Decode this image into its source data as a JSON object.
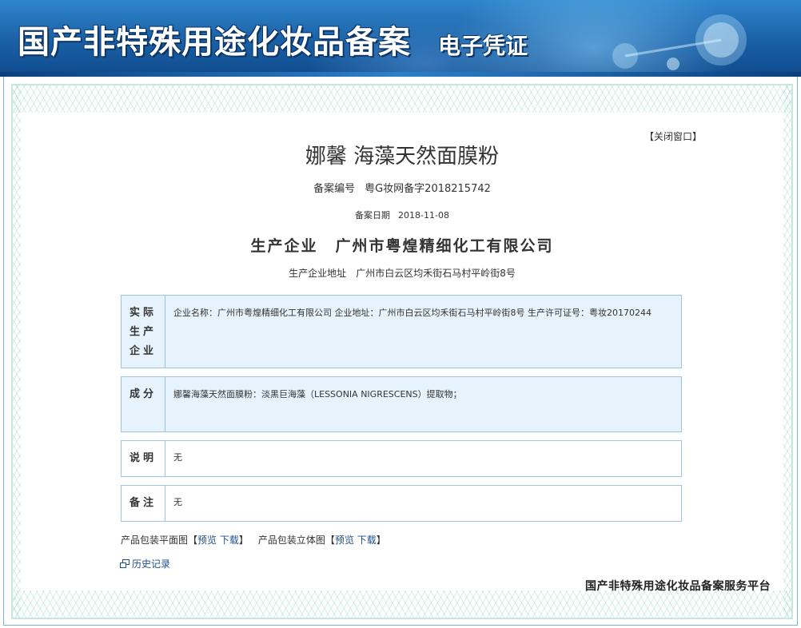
{
  "header": {
    "title": "国产非特殊用途化妆品备案",
    "subtitle": "电子凭证"
  },
  "close_window": "【关闭窗口】",
  "product": {
    "name": "娜馨 海藻天然面膜粉",
    "reg_no_label": "备案编号",
    "reg_no_value": "粤G妆网备字2018215742",
    "reg_date_label": "备案日期",
    "reg_date_value": "2018-11-08",
    "company_label": "生产企业",
    "company_value": "广州市粤煌精细化工有限公司",
    "company_addr_label": "生产企业地址",
    "company_addr_value": "广州市白云区均禾街石马村平岭街8号"
  },
  "sections": {
    "actual_producer": {
      "label_lines": [
        "实际",
        "生产",
        "企业"
      ],
      "content": "企业名称：广州市粤煌精细化工有限公司  企业地址：广州市白云区均禾街石马村平岭街8号  生产许可证号：粤妆20170244"
    },
    "ingredients": {
      "label": "成分",
      "content": "娜馨海藻天然面膜粉：淡黑巨海藻（LESSONIA NIGRESCENS）提取物；"
    },
    "description": {
      "label": "说明",
      "content": "无"
    },
    "remarks": {
      "label": "备注",
      "content": "无"
    }
  },
  "packaging": {
    "flat_label": "产品包装平面图",
    "flat_open": "【",
    "flat_preview": "预览",
    "flat_download": "下载",
    "flat_close": "】",
    "solid_label": "产品包装立体图",
    "solid_open": "【",
    "solid_preview": "预览",
    "solid_download": "下载",
    "solid_close": "】"
  },
  "history_label": "历史记录",
  "footer_platform": "国产非特殊用途化妆品备案服务平台",
  "colors": {
    "banner": "#1a5fa5",
    "box_bg": "#e6f3fc",
    "box_border": "#9cc6e0",
    "link": "#1d4f8a"
  },
  "icons": {
    "history": "window-icon"
  }
}
